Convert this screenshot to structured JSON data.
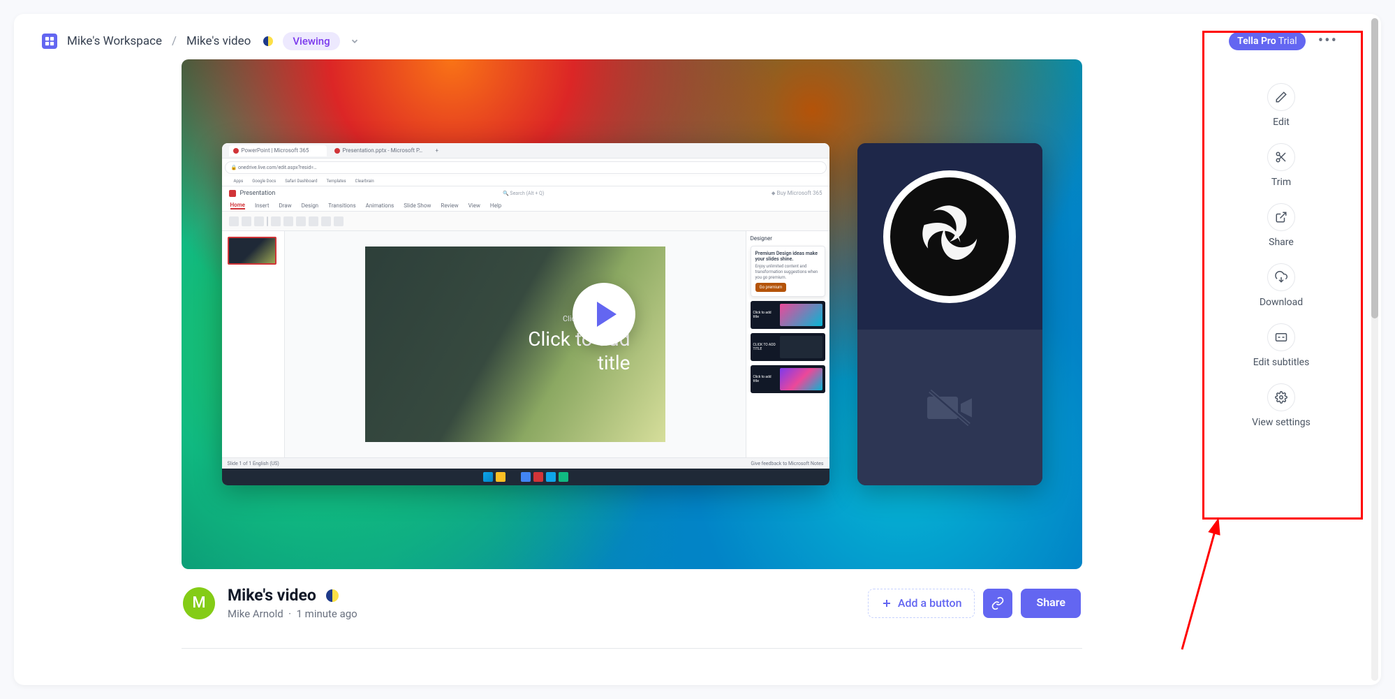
{
  "breadcrumb": {
    "workspace": "Mike's Workspace",
    "separator": "/",
    "video": "Mike's video",
    "viewing_label": "Viewing"
  },
  "header": {
    "badge_main": "Tella Pro",
    "badge_suffix": "Trial",
    "more": "•••"
  },
  "rail": {
    "edit": "Edit",
    "trim": "Trim",
    "share": "Share",
    "download": "Download",
    "subtitles": "Edit subtitles",
    "view_settings": "View settings"
  },
  "video_meta": {
    "avatar_letter": "M",
    "title": "Mike's video",
    "author": "Mike Arnold",
    "dot": "·",
    "time": "1 minute ago"
  },
  "actions": {
    "add": "Add a button",
    "share": "Share"
  },
  "screen": {
    "tab1": "PowerPoint | Microsoft 365",
    "tab2": "Presentation.pptx - Microsoft P…",
    "doc_name": "Presentation",
    "search_placeholder": "Search (Alt + Q)",
    "buy": "Buy Microsoft 365",
    "ribbon_tabs": [
      "Home",
      "Insert",
      "Draw",
      "Design",
      "Transitions",
      "Animations",
      "Slide Show",
      "Review",
      "View",
      "Help"
    ],
    "slide_sub": "Click to add subtitle",
    "slide_title_1": "Click to add",
    "slide_title_2": "title",
    "designer_label": "Designer",
    "tip_title": "Premium Design ideas make your slides shine.",
    "tip_body": "Enjoy unlimited content and transformation suggestions when you go premium.",
    "go_premium": "Go premium",
    "design_alt_1": "Click to add title",
    "design_alt_2": "CLICK TO ADD TITLE",
    "status_left": "Slide 1 of 1   English (US)",
    "status_right": "Give feedback to Microsoft    Notes"
  }
}
